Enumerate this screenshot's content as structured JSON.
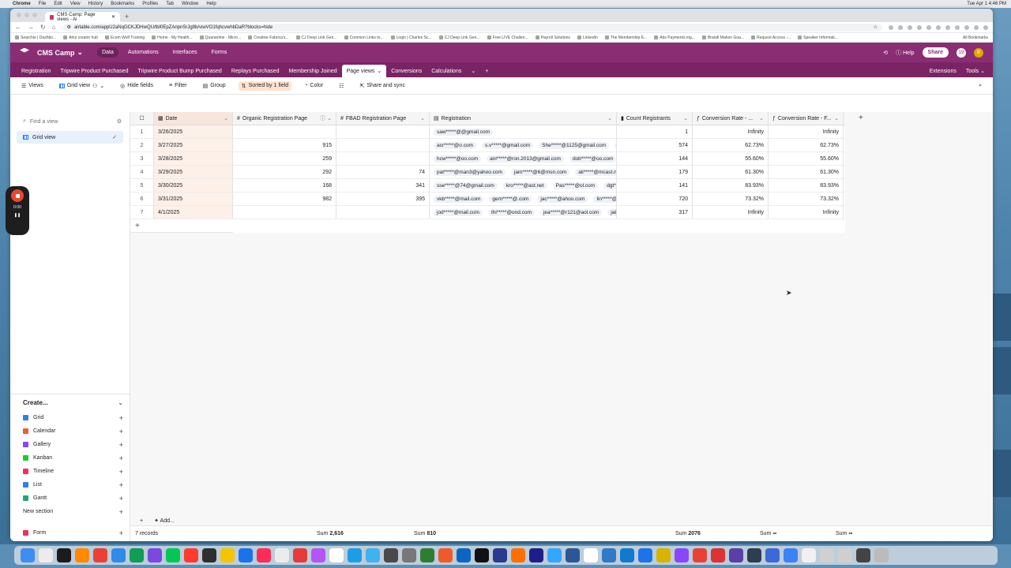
{
  "menubar": {
    "app": "Chrome",
    "items": [
      "File",
      "Edit",
      "View",
      "History",
      "Bookmarks",
      "Profiles",
      "Tab",
      "Window",
      "Help"
    ],
    "clock": "Tue Apr 1  4:46 PM"
  },
  "browser": {
    "tab_title": "CMS Camp: Page views - Ai",
    "url": "airtable.com/appU2aNqGCKJDHwQU/tbl0EpZAnpnSrJg9b/viwVO1fqhcvwhbDaR?blocks=hide",
    "bookmarks": [
      "Searchie | Dashbo...",
      "Amz creator hub",
      "Ecom Wolf Training",
      "Home - My Health...",
      "Quarantine - Micro...",
      "Creative Fabrica's...",
      "CJ Deep Link Gen...",
      "Common Links to...",
      "Login | Charles Sc...",
      "CJ Deep Link Gen...",
      "Free LIVE Challen...",
      "Payroll Solutions",
      "LinkedIn",
      "The Membership E...",
      "Ads Payments.mg...",
      "Brandi Mahon Goa...",
      "Request Access -...",
      "Speaker Informati..."
    ],
    "all_bookmarks": "All Bookmarks"
  },
  "header": {
    "base_name": "CMS Camp",
    "nav": [
      "Data",
      "Automations",
      "Interfaces",
      "Forms"
    ],
    "active_nav": "Data",
    "help": "Help",
    "share": "Share",
    "notif_count": "19",
    "avatar": "B"
  },
  "table_tabs": {
    "tabs": [
      "Registration",
      "Tripwire Product Purchased",
      "Tripwire Product Bump Purchased",
      "Replays Purchased",
      "Membership Joined",
      "Page views",
      "Conversions",
      "Calculations"
    ],
    "active": "Page views",
    "extensions": "Extensions",
    "tools": "Tools"
  },
  "toolbar": {
    "views": "Views",
    "grid_view": "Grid view",
    "hide_fields": "Hide fields",
    "filter": "Filter",
    "group": "Group",
    "sorted": "Sorted by 1 field",
    "color": "Color",
    "share_sync": "Share and sync"
  },
  "sidebar": {
    "find_placeholder": "Find a view",
    "active_view": "Grid view",
    "create_label": "Create...",
    "create_items": [
      {
        "label": "Grid",
        "color": "#2d7ff9"
      },
      {
        "label": "Calendar",
        "color": "#e8612c"
      },
      {
        "label": "Gallery",
        "color": "#8b46ff"
      },
      {
        "label": "Kanban",
        "color": "#20c933"
      },
      {
        "label": "Timeline",
        "color": "#f82b60"
      },
      {
        "label": "List",
        "color": "#2d7ff9"
      },
      {
        "label": "Gantt",
        "color": "#20a974"
      }
    ],
    "new_section": "New section",
    "form": "Form"
  },
  "grid": {
    "columns": [
      "Date",
      "Organic Registration Page",
      "FBAD Registration Page",
      "Registration",
      "Count Registrants",
      "Conversion Rate - ...",
      "Conversion Rate - F..."
    ],
    "rows": [
      {
        "n": "1",
        "date": "3/26/2025",
        "organic": "",
        "fbad": "",
        "emails": [
          "saw*****@@gmail.com"
        ],
        "count": "1",
        "rate1": "Infinity",
        "rate2": "Infinity"
      },
      {
        "n": "2",
        "date": "3/27/2025",
        "organic": "915",
        "fbad": "",
        "emails": [
          "acr*****@o.com",
          "s.v*****@gmail.com",
          "She*****@1125@gmail.com",
          "pts"
        ],
        "count": "574",
        "rate1": "62.73%",
        "rate2": "62.73%"
      },
      {
        "n": "3",
        "date": "3/28/2025",
        "organic": "259",
        "fbad": "",
        "emails": [
          "hcw*****@oo.com",
          "ani*****@ron.2013@gmail.com",
          "dob*****@oo.com"
        ],
        "count": "144",
        "rate1": "55.60%",
        "rate2": "55.60%"
      },
      {
        "n": "4",
        "date": "3/29/2025",
        "organic": "292",
        "fbad": "74",
        "emails": [
          "pat*****@man3@yahoo.com",
          "jam*****@6@msn.com",
          "ali*****@mcast.ne"
        ],
        "count": "179",
        "rate1": "61.30%",
        "rate2": "61.30%"
      },
      {
        "n": "5",
        "date": "3/30/2025",
        "organic": "168",
        "fbad": "341",
        "emails": [
          "sse*****@74@gmail.com",
          "kro*****@ast.net",
          "Pas*****@ol.com",
          "dgt*****"
        ],
        "count": "141",
        "rate1": "83.93%",
        "rate2": "83.93%"
      },
      {
        "n": "6",
        "date": "3/31/2025",
        "organic": "982",
        "fbad": "395",
        "emails": [
          "vkb*****@mail.com",
          "gem*****@.com",
          "jac*****@ahoo.com",
          "lin*****@63"
        ],
        "count": "720",
        "rate1": "73.32%",
        "rate2": "73.32%"
      },
      {
        "n": "7",
        "date": "4/1/2025",
        "organic": "",
        "fbad": "",
        "emails": [
          "jod*****@mail.com",
          "thi*****@ond.com",
          "jea*****@r121@aol.com",
          "jab***"
        ],
        "count": "317",
        "rate1": "Infinity",
        "rate2": "Infinity"
      }
    ],
    "records": "7 records",
    "sum_label": "Sum",
    "sum_organic": "2,616",
    "sum_fbad": "810",
    "sum_count": "2076",
    "sum_rate1": "∞",
    "sum_rate2": "∞",
    "add_label": "Add..."
  },
  "recorder": {
    "time": "0:00"
  }
}
